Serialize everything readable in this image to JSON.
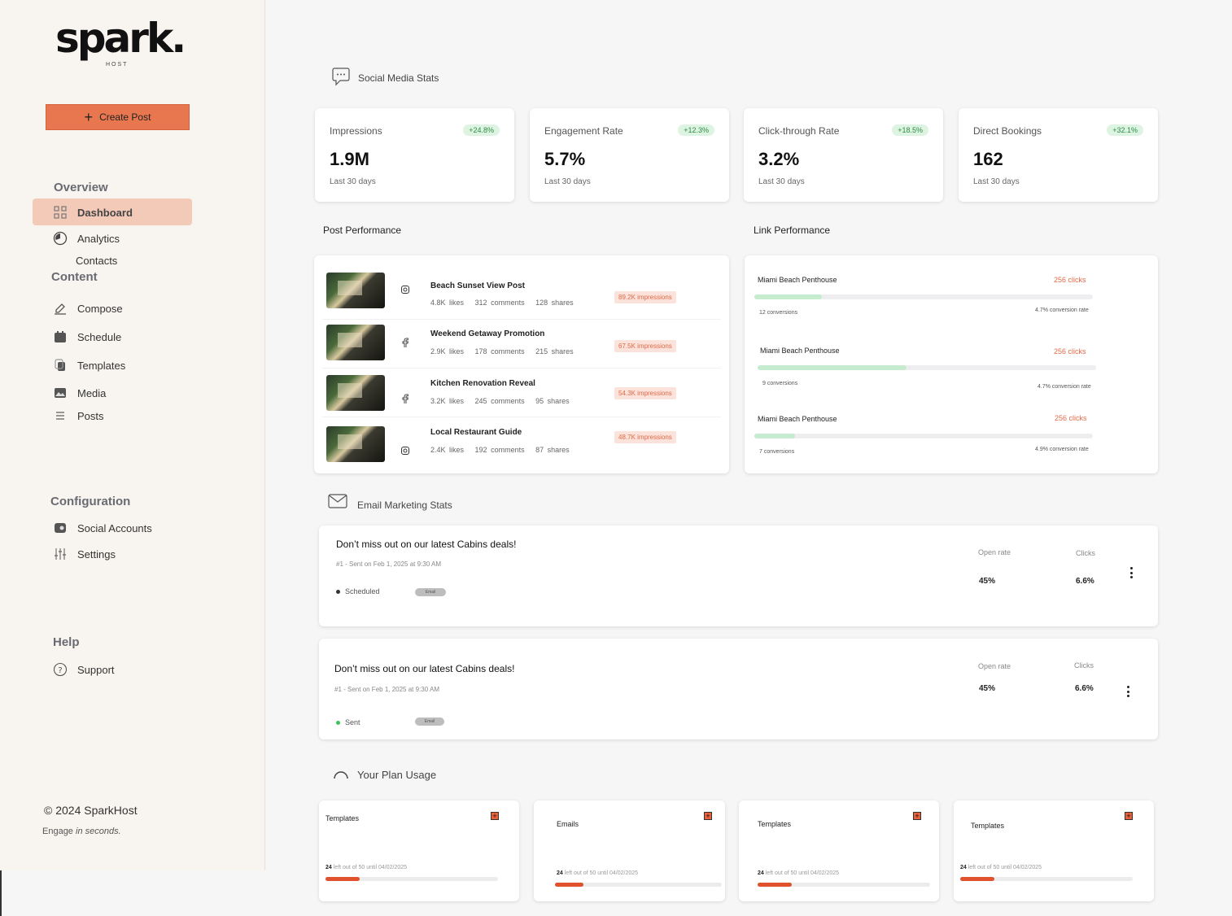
{
  "brand": {
    "logo_text": "spark.",
    "logo_sub": "HOST"
  },
  "sidebar": {
    "create_label": "Create Post",
    "overview_label": "Overview",
    "content_label": "Content",
    "config_label": "Configuration",
    "help_label": "Help",
    "items": {
      "dashboard": "Dashboard",
      "analytics": "Analytics",
      "contacts": "Contacts",
      "compose": "Compose",
      "schedule": "Schedule",
      "templates": "Templates",
      "media": "Media",
      "posts": "Posts",
      "social_accounts": "Social Accounts",
      "settings": "Settings",
      "support": "Support"
    },
    "copyright": "© 2024 SparkHost",
    "tagline_a": "Engage",
    "tagline_b": "in seconds."
  },
  "social": {
    "heading": "Social Media Stats",
    "stats": [
      {
        "title": "Impressions",
        "badge": "+24.8%",
        "value": "1.9M",
        "sub": "Last 30 days"
      },
      {
        "title": "Engagement Rate",
        "badge": "+12.3%",
        "value": "5.7%",
        "sub": "Last 30 days"
      },
      {
        "title": "Click-through Rate",
        "badge": "+18.5%",
        "value": "3.2%",
        "sub": "Last 30 days"
      },
      {
        "title": "Direct Bookings",
        "badge": "+32.1%",
        "value": "162",
        "sub": "Last 30 days"
      }
    ]
  },
  "post_performance": {
    "heading": "Post Performance",
    "posts": [
      {
        "platform": "instagram",
        "name": "Beach Sunset View Post",
        "likes": "4.8K likes",
        "comments": "312 comments",
        "shares": "128 shares",
        "impressions": "89.2K impressions"
      },
      {
        "platform": "facebook",
        "name": "Weekend Getaway Promotion",
        "likes": "2.9K likes",
        "comments": "178 comments",
        "shares": "215 shares",
        "impressions": "67.5K impressions"
      },
      {
        "platform": "facebook",
        "name": "Kitchen Renovation Reveal",
        "likes": "3.2K likes",
        "comments": "245 comments",
        "shares": "95 shares",
        "impressions": "54.3K impressions"
      },
      {
        "platform": "instagram",
        "name": "Local Restaurant Guide",
        "likes": "2.4K likes",
        "comments": "192 comments",
        "shares": "87 shares",
        "impressions": "48.7K impressions"
      }
    ]
  },
  "link_performance": {
    "heading": "Link Performance",
    "links": [
      {
        "name": "Miami Beach Penthouse",
        "clicks": "256 clicks",
        "conversions": "12 conversions",
        "rate": "4.7% conversion rate",
        "progress": 0.2
      },
      {
        "name": "Miami Beach Penthouse",
        "clicks": "256 clicks",
        "conversions": "9 conversions",
        "rate": "4.7% conversion rate",
        "progress": 0.44
      },
      {
        "name": "Miami Beach Penthouse",
        "clicks": "256 clicks",
        "conversions": "7 conversions",
        "rate": "4.9% conversion rate",
        "progress": 0.12
      }
    ]
  },
  "email": {
    "heading": "Email Marketing Stats",
    "campaigns": [
      {
        "title": "Don’t miss out on our latest Cabins deals!",
        "sub": "#1 - Sent on Feb 1, 2025 at 9:30 AM",
        "status": "Scheduled",
        "status_color": "#333333",
        "pill": "Email",
        "open_label": "Open rate",
        "open": "45%",
        "clicks_label": "Clicks",
        "clicks": "6.6%"
      },
      {
        "title": "Don’t miss out on our latest Cabins deals!",
        "sub": "#1 - Sent on Feb 1, 2025 at 9:30 AM",
        "status": "Sent",
        "status_color": "#3cc35a",
        "pill": "Email",
        "open_label": "Open rate",
        "open": "45%",
        "clicks_label": "Clicks",
        "clicks": "6.6%"
      }
    ]
  },
  "plan": {
    "heading": "Your Plan Usage",
    "items": [
      {
        "title": "Templates",
        "count": "24",
        "text": "left out of 50 until 04/02/2025",
        "progress": 0.2
      },
      {
        "title": "Emails",
        "count": "24",
        "text": "left out of 50 until 04/02/2025",
        "progress": 0.17
      },
      {
        "title": "Templates",
        "count": "24",
        "text": "left out of 50 until 04/02/2025",
        "progress": 0.2
      },
      {
        "title": "Templates",
        "count": "24",
        "text": "left out of 50 until 04/02/2025",
        "progress": 0.2
      }
    ]
  },
  "colors": {
    "accent": "#e8774f",
    "active_bg": "#f3c9b8",
    "positive": "#2e8a44",
    "impression": "#e06a48"
  }
}
